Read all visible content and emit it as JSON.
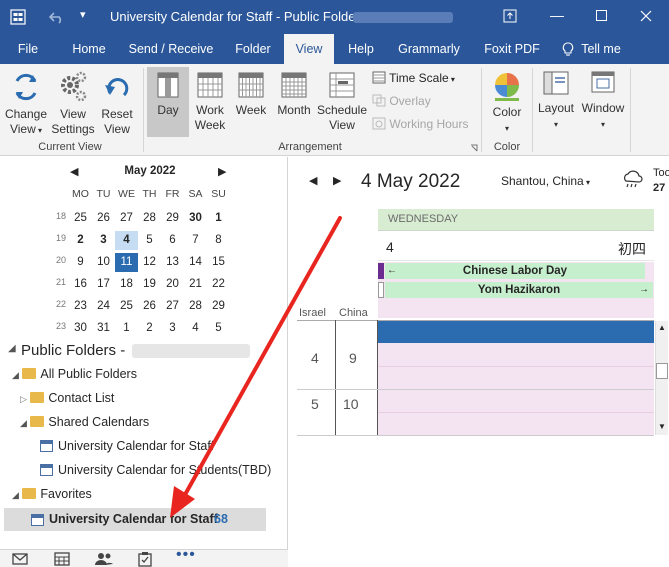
{
  "window": {
    "title": "University Calendar for Staff - Public Folders -",
    "colors": {
      "accent": "#2b579a",
      "today": "#2b579a",
      "event": "#c6efce",
      "all_day": "#e2efda"
    }
  },
  "tabs": [
    "File",
    "Home",
    "Send / Receive",
    "Folder",
    "View",
    "Help",
    "Grammarly",
    "Foxit PDF",
    "Tell me"
  ],
  "active_tab": "View",
  "ribbon": {
    "change_view_1": "Change",
    "change_view_2": "View",
    "view_settings_1": "View",
    "view_settings_2": "Settings",
    "reset_view_1": "Reset",
    "reset_view_2": "View",
    "group_current_view": "Current View",
    "day": "Day",
    "work_week_1": "Work",
    "work_week_2": "Week",
    "week": "Week",
    "month": "Month",
    "schedule_view_1": "Schedule",
    "schedule_view_2": "View",
    "time_scale": "Time Scale",
    "overlay": "Overlay",
    "working_hours": "Working Hours",
    "group_arrangement": "Arrangement",
    "color": "Color",
    "group_color": "Color",
    "layout": "Layout",
    "window": "Window"
  },
  "mini_calendar": {
    "month_label": "May 2022",
    "weekdays": [
      "MO",
      "TU",
      "WE",
      "TH",
      "FR",
      "SA",
      "SU"
    ],
    "weeks": [
      {
        "num": "18",
        "days": [
          "25",
          "26",
          "27",
          "28",
          "29",
          "30",
          "1"
        ]
      },
      {
        "num": "19",
        "days": [
          "2",
          "3",
          "4",
          "5",
          "6",
          "7",
          "8"
        ]
      },
      {
        "num": "20",
        "days": [
          "9",
          "10",
          "11",
          "12",
          "13",
          "14",
          "15"
        ]
      },
      {
        "num": "21",
        "days": [
          "16",
          "17",
          "18",
          "19",
          "20",
          "21",
          "22"
        ]
      },
      {
        "num": "22",
        "days": [
          "23",
          "24",
          "25",
          "26",
          "27",
          "28",
          "29"
        ]
      },
      {
        "num": "23",
        "days": [
          "30",
          "31",
          "1",
          "2",
          "3",
          "4",
          "5"
        ]
      }
    ]
  },
  "folders": {
    "root": "Public Folders -",
    "all_public": "All Public Folders",
    "contact_list": "Contact List",
    "shared_calendars": "Shared Calendars",
    "cal_staff": "University Calendar for Staff",
    "cal_students": "University Calendar for Students(TBD)",
    "favorites": "Favorites",
    "fav_staff": "University Calendar for Staff",
    "fav_count": "68"
  },
  "calendar": {
    "date_title": "4 May 2022",
    "location": "Shantou, China",
    "weather_today": "Too",
    "weather_temp": "27",
    "weekday": "WEDNESDAY",
    "day_num": "4",
    "lunar": "初四",
    "all_day_events": [
      "Chinese Labor Day",
      "Yom Hazikaron"
    ],
    "timezones": [
      "Israel",
      "China"
    ],
    "hours": [
      {
        "israel": "4",
        "china": "9"
      },
      {
        "israel": "5",
        "china": "10"
      }
    ]
  }
}
